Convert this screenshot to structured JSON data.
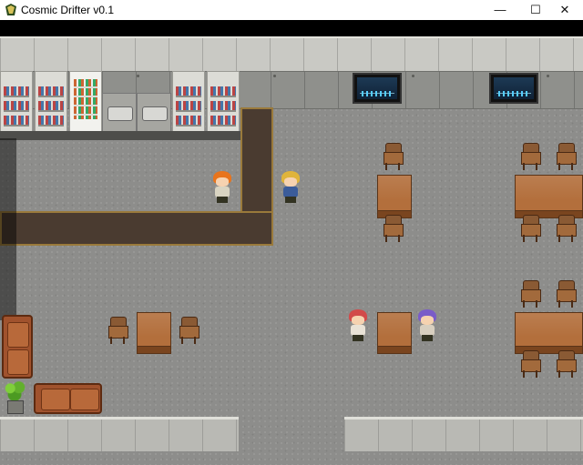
{
  "window": {
    "title": "Cosmic Drifter v0.1",
    "controls": {
      "minimize": "—",
      "maximize": "☐",
      "close": "✕"
    }
  },
  "icons": [
    "app-icon",
    "minimize-icon",
    "maximize-icon",
    "close-icon"
  ],
  "scene": {
    "location": "spaceship cafeteria",
    "characters": [
      {
        "id": "orange-hair-cook",
        "colors": {
          "hair": "#e8741c",
          "outfit": "#d9d4c2"
        }
      },
      {
        "id": "blonde-hero",
        "colors": {
          "hair": "#e0b43a",
          "outfit": "#3b5c9a"
        }
      },
      {
        "id": "red-hair-girl",
        "colors": {
          "hair": "#d24a4a",
          "outfit": "#e9e2d6"
        }
      },
      {
        "id": "purple-hair-girl",
        "colors": {
          "hair": "#7a5cc8",
          "outfit": "#d8cfc0"
        }
      }
    ],
    "colors": {
      "floor": "#8d8d8b",
      "wall": "#c9c9c4",
      "wood": "#b36f3c",
      "sofa": "#a0522d"
    }
  }
}
